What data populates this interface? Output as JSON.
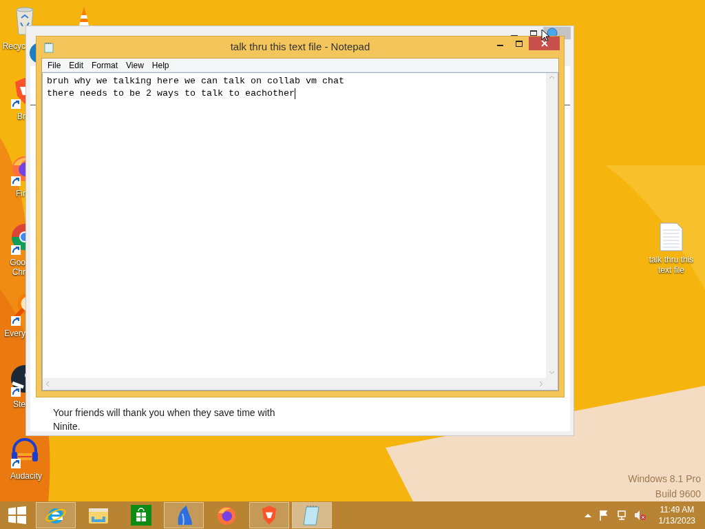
{
  "desktop_icons": [
    {
      "kind": "recycle-bin",
      "label_lines": [
        "Recyc"
      ],
      "partly_hidden": true
    },
    {
      "kind": "vlc"
    },
    {
      "kind": "brave",
      "label_lines": [
        "Br"
      ],
      "partly_hidden": true
    },
    {
      "kind": "firefox",
      "label_lines": [
        "Fir"
      ],
      "partly_hidden": true
    },
    {
      "kind": "chrome",
      "label_lines": [
        "Goo",
        "Chr"
      ],
      "partly_hidden": true
    },
    {
      "kind": "everything",
      "label_lines": [
        "Every"
      ],
      "partly_hidden": true
    },
    {
      "kind": "steam",
      "label_lines": [
        "Ste"
      ],
      "partly_hidden": true
    },
    {
      "kind": "audacity",
      "label_lines": [
        "Audacity"
      ],
      "partly_hidden": false
    }
  ],
  "desktop_file": {
    "label": "talk thru this text file"
  },
  "background_window": {
    "message": "Your friends will thank you when they save time with Ninite."
  },
  "notepad": {
    "title": "talk thru this text file - Notepad",
    "menu": [
      "File",
      "Edit",
      "Format",
      "View",
      "Help"
    ],
    "lines": [
      "bruh why we talking here we can talk on collab vm chat",
      "there needs to be 2 ways to talk to eachother"
    ],
    "caret_visible": true
  },
  "watermark": [
    "Windows 8.1 Pro",
    "Build 9600"
  ],
  "taskbar": {
    "apps": [
      {
        "kind": "internet-explorer",
        "running": true,
        "selected": false
      },
      {
        "kind": "file-explorer",
        "running": false,
        "selected": false
      },
      {
        "kind": "store",
        "running": false,
        "selected": false
      },
      {
        "kind": "shark",
        "running": true,
        "selected": false
      },
      {
        "kind": "firefox",
        "running": false,
        "selected": false
      },
      {
        "kind": "brave",
        "running": true,
        "selected": false
      },
      {
        "kind": "notepad",
        "running": true,
        "selected": true
      }
    ],
    "clock": {
      "time": "11:49 AM",
      "date": "1/13/2023"
    }
  }
}
